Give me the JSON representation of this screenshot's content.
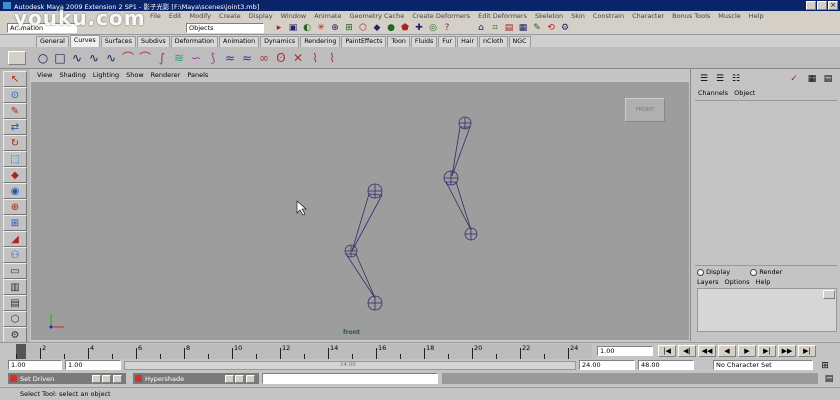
{
  "watermark": "youku.com",
  "title_bar": {
    "text": "Autodesk Maya 2009 Extension 2 SP1 - 影子光影 [F:\\Maya\\scenes\\joint3.mb]"
  },
  "main_menu": [
    "File",
    "Edit",
    "Modify",
    "Create",
    "Display",
    "Window",
    "Animate",
    "Geometry Cache",
    "Create Deformers",
    "Edit Deformers",
    "Skeleton",
    "Skin",
    "Constrain",
    "Character",
    "Bonus Tools",
    "Muscle",
    "Help"
  ],
  "status_line": {
    "menu_set": "Animation",
    "selection_mode": "Objects"
  },
  "shelf": {
    "tabs": [
      "General",
      "Curves",
      "Surfaces",
      "Subdivs",
      "Deformation",
      "Animation",
      "Dynamics",
      "Rendering",
      "PaintEffects",
      "Toon",
      "Fluids",
      "Fur",
      "Hair",
      "nCloth",
      "NGC"
    ],
    "active_tab": "Curves",
    "icons": [
      "circle-curve-icon",
      "square-curve-icon",
      "cv-curve-icon",
      "ep-curve-icon",
      "pencil-curve-icon",
      "arc-icon",
      "arc-two-icon",
      "curve-edit-icon",
      "offset-curve-icon",
      "rebuild-curve-icon",
      "fillet-icon",
      "wave-curve-icon",
      "wavy-curve-icon",
      "loop-curve-icon",
      "spiral-icon",
      "cross-curve-icon",
      "attach-curve-icon",
      "detach-curve-icon"
    ]
  },
  "panel_menu": [
    "View",
    "Shading",
    "Lighting",
    "Show",
    "Renderer",
    "Panels"
  ],
  "viewport": {
    "camera_label": "FRONT",
    "frame_label": "front"
  },
  "channel_box": {
    "menu": [
      "Channels",
      "Object"
    ]
  },
  "layer_editor": {
    "display": "Display",
    "render": "Render",
    "menu": [
      "Layers",
      "Options",
      "Help"
    ]
  },
  "time_slider": {
    "ticks": [
      "2",
      "4",
      "6",
      "8",
      "10",
      "12",
      "14",
      "16",
      "18",
      "20",
      "22",
      "24"
    ],
    "current_frame": "1.00"
  },
  "range_slider": {
    "start_time": "1.00",
    "start_range": "1.00",
    "range_field": "24.00",
    "end_range": "24.00",
    "end_time": "48.00",
    "character_set": "No Character Set",
    "range_handle_label": "24.00"
  },
  "taskbar": {
    "items": [
      "Set Driven",
      "Hypershade"
    ]
  },
  "help_line": "Select Tool: select an object"
}
